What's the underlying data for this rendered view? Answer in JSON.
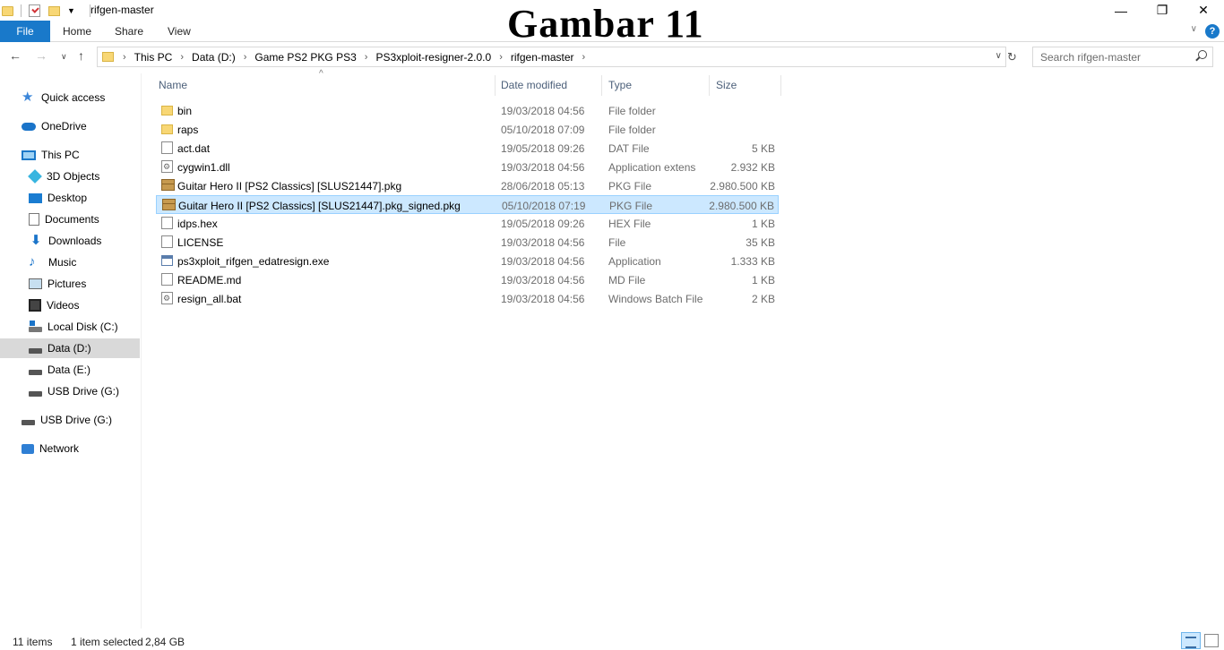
{
  "window": {
    "title": "rifgen-master",
    "watermark": "Gambar 11",
    "minimize": "—",
    "maximize": "❐",
    "close": "✕"
  },
  "ribbon": {
    "tabs": [
      "File",
      "Home",
      "Share",
      "View"
    ],
    "help": "?"
  },
  "address": {
    "crumbs": [
      "This PC",
      "Data (D:)",
      "Game PS2 PKG PS3",
      "PS3xploit-resigner-2.0.0",
      "rifgen-master"
    ],
    "separator": "›"
  },
  "search": {
    "placeholder": "Search rifgen-master"
  },
  "nav": {
    "items": [
      {
        "label": "Quick access",
        "icon": "star-icon"
      },
      {
        "label": "OneDrive",
        "icon": "cloud-icon"
      },
      {
        "label": "This PC",
        "icon": "computer-icon"
      },
      {
        "label": "3D Objects",
        "icon": "cube-icon"
      },
      {
        "label": "Desktop",
        "icon": "desktop-icon"
      },
      {
        "label": "Documents",
        "icon": "documents-icon"
      },
      {
        "label": "Downloads",
        "icon": "download-icon"
      },
      {
        "label": "Music",
        "icon": "music-icon"
      },
      {
        "label": "Pictures",
        "icon": "pictures-icon"
      },
      {
        "label": "Videos",
        "icon": "videos-icon"
      },
      {
        "label": "Local Disk (C:)",
        "icon": "windows-drive-icon"
      },
      {
        "label": "Data (D:)",
        "icon": "drive-icon"
      },
      {
        "label": "Data (E:)",
        "icon": "drive-icon"
      },
      {
        "label": "USB Drive (G:)",
        "icon": "drive-icon"
      },
      {
        "label": "USB Drive (G:)",
        "icon": "drive-icon"
      },
      {
        "label": "Network",
        "icon": "network-icon"
      }
    ],
    "selected": "Data (D:)"
  },
  "columns": {
    "name": "Name",
    "date": "Date modified",
    "type": "Type",
    "size": "Size"
  },
  "files": [
    {
      "name": "bin",
      "date": "19/03/2018 04:56",
      "type": "File folder",
      "size": "",
      "icon": "folder-icon"
    },
    {
      "name": "raps",
      "date": "05/10/2018 07:09",
      "type": "File folder",
      "size": "",
      "icon": "folder-icon"
    },
    {
      "name": "act.dat",
      "date": "19/05/2018 09:26",
      "type": "DAT File",
      "size": "5 KB",
      "icon": "file-icon"
    },
    {
      "name": "cygwin1.dll",
      "date": "19/03/2018 04:56",
      "type": "Application extens",
      "size": "2.932 KB",
      "icon": "dll-icon"
    },
    {
      "name": "Guitar Hero II [PS2 Classics] [SLUS21447].pkg",
      "date": "28/06/2018 05:13",
      "type": "PKG File",
      "size": "2.980.500 KB",
      "icon": "package-icon"
    },
    {
      "name": "Guitar Hero II [PS2 Classics] [SLUS21447].pkg_signed.pkg",
      "date": "05/10/2018 07:19",
      "type": "PKG File",
      "size": "2.980.500 KB",
      "icon": "package-icon"
    },
    {
      "name": "idps.hex",
      "date": "19/05/2018 09:26",
      "type": "HEX File",
      "size": "1 KB",
      "icon": "file-icon"
    },
    {
      "name": "LICENSE",
      "date": "19/03/2018 04:56",
      "type": "File",
      "size": "35 KB",
      "icon": "file-icon"
    },
    {
      "name": "ps3xploit_rifgen_edatresign.exe",
      "date": "19/03/2018 04:56",
      "type": "Application",
      "size": "1.333 KB",
      "icon": "exe-icon"
    },
    {
      "name": "README.md",
      "date": "19/03/2018 04:56",
      "type": "MD File",
      "size": "1 KB",
      "icon": "file-icon"
    },
    {
      "name": "resign_all.bat",
      "date": "19/03/2018 04:56",
      "type": "Windows Batch File",
      "size": "2 KB",
      "icon": "dll-icon"
    }
  ],
  "selected_file": "Guitar Hero II [PS2 Classics] [SLUS21447].pkg_signed.pkg",
  "status": {
    "count": "11 items",
    "selection": "1 item selected",
    "size": "2,84 GB"
  }
}
